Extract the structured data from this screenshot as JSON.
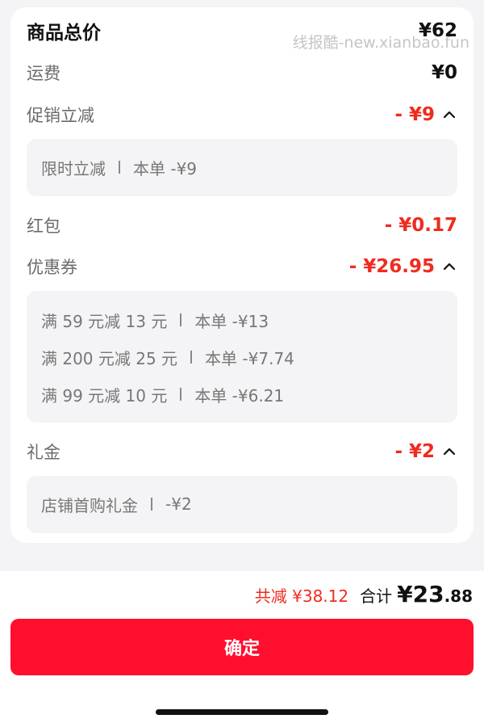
{
  "goods_total": {
    "label": "商品总价",
    "value": "¥62"
  },
  "watermark": "线报酷-new.xianbao.fun",
  "shipping": {
    "label": "运费",
    "value": "¥0"
  },
  "promo": {
    "label": "促销立减",
    "value": "- ¥9",
    "details": [
      {
        "name": "限时立减",
        "amount": "本单 -¥9"
      }
    ]
  },
  "red_packet": {
    "label": "红包",
    "value": "- ¥0.17"
  },
  "coupon": {
    "label": "优惠券",
    "value": "- ¥26.95",
    "details": [
      {
        "name": "满 59 元减 13 元",
        "amount": "本单 -¥13"
      },
      {
        "name": "满 200 元减 25 元",
        "amount": "本单 -¥7.74"
      },
      {
        "name": "满 99 元减 10 元",
        "amount": "本单 -¥6.21"
      }
    ]
  },
  "gift": {
    "label": "礼金",
    "value": "- ¥2",
    "details": [
      {
        "name": "店铺首购礼金",
        "amount": "-¥2"
      }
    ]
  },
  "footer": {
    "saved": "共减 ¥38.12",
    "total_label": "合计",
    "total_integer": "¥23",
    "total_decimal": ".88",
    "confirm_label": "确定"
  },
  "colors": {
    "accent_red": "#f02b1e",
    "button_red": "#ff0f2e"
  },
  "icons": {
    "expand": "chevron-up-icon"
  }
}
